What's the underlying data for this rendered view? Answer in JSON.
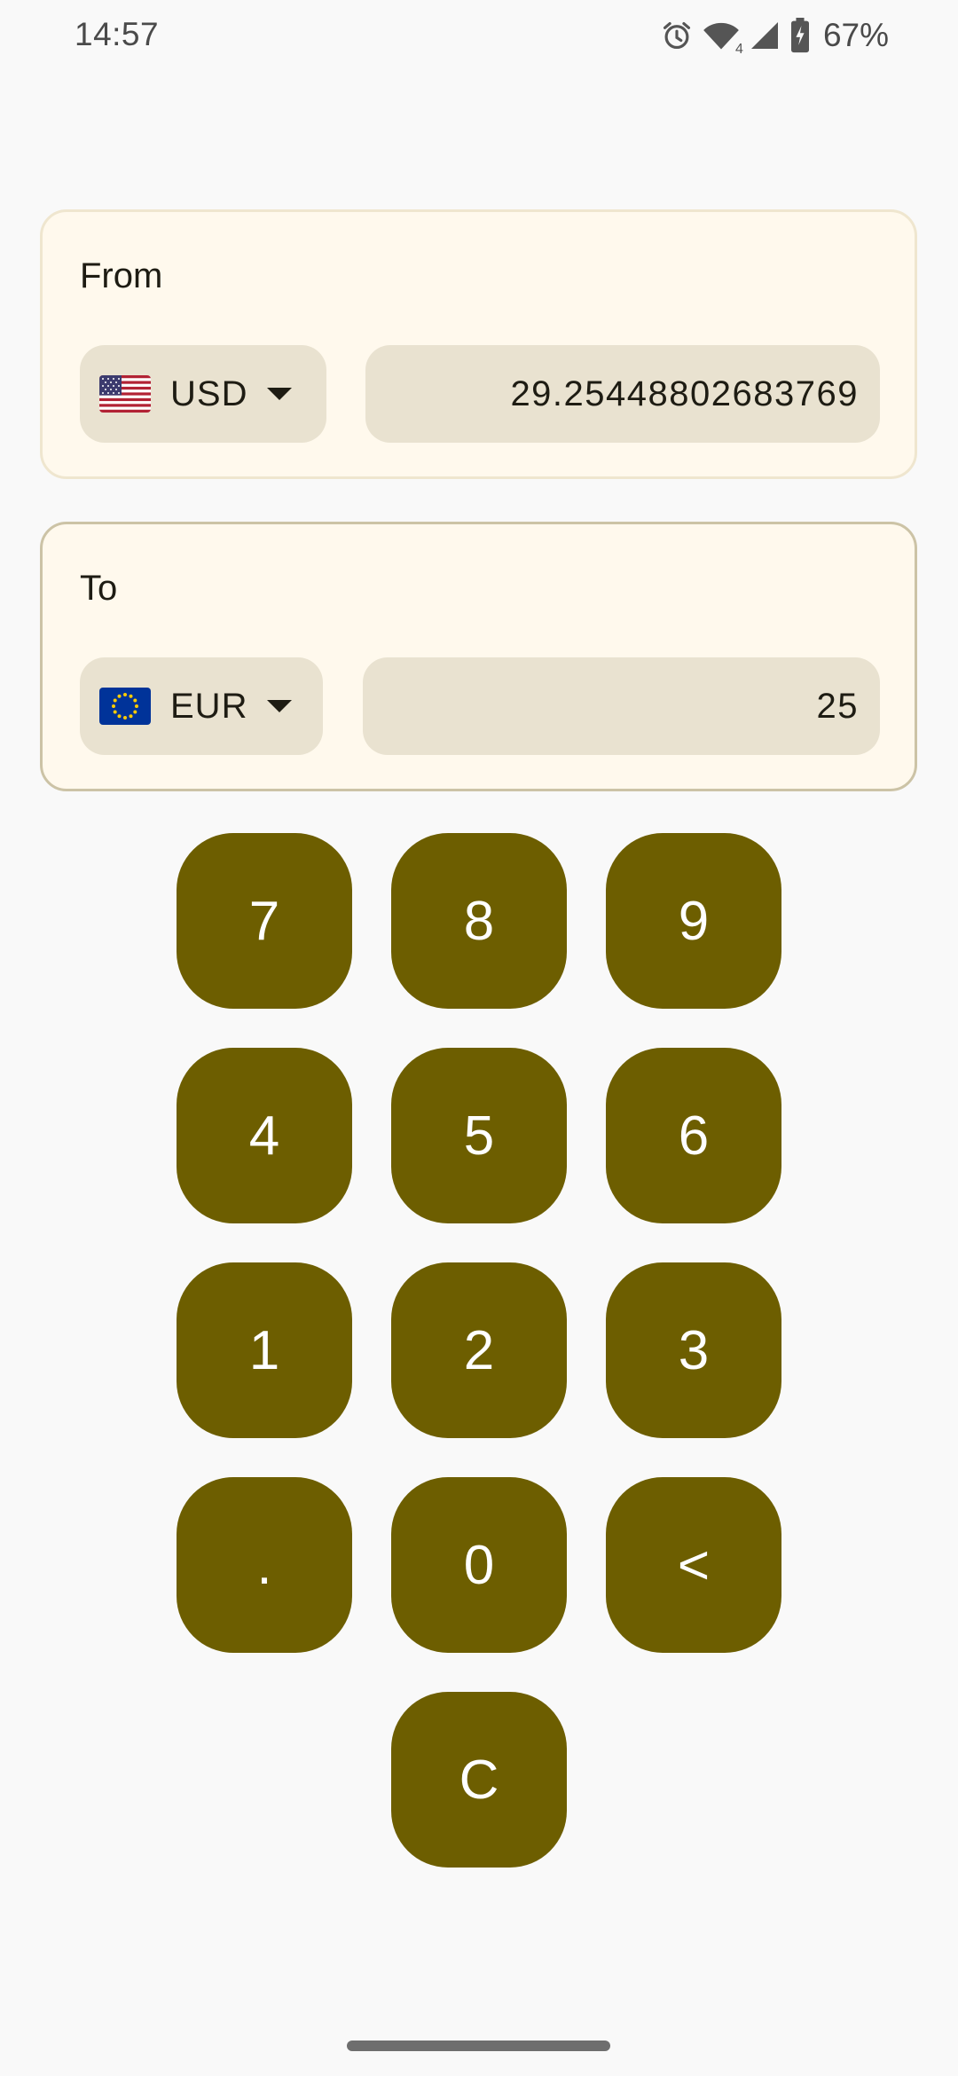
{
  "status_bar": {
    "time": "14:57",
    "network_badge": "4",
    "battery_percent": "67%",
    "icons": [
      "alarm-icon",
      "wifi-icon",
      "cell-signal-icon",
      "battery-charging-icon"
    ]
  },
  "from_card": {
    "label": "From",
    "currency": {
      "code": "USD",
      "flag": "us-flag-icon"
    },
    "amount": "29.25448802683769"
  },
  "to_card": {
    "label": "To",
    "currency": {
      "code": "EUR",
      "flag": "eu-flag-icon"
    },
    "amount": "25"
  },
  "keypad": {
    "k7": "7",
    "k8": "8",
    "k9": "9",
    "k4": "4",
    "k5": "5",
    "k6": "6",
    "k1": "1",
    "k2": "2",
    "k3": "3",
    "kdot": ".",
    "k0": "0",
    "kback": "<",
    "kclear": "C"
  },
  "colors": {
    "background": "#f9f9f9",
    "card_background": "#fff9ed",
    "field_background": "#e9e2d0",
    "key_background": "#6d5e00",
    "key_text": "#ffffff"
  }
}
